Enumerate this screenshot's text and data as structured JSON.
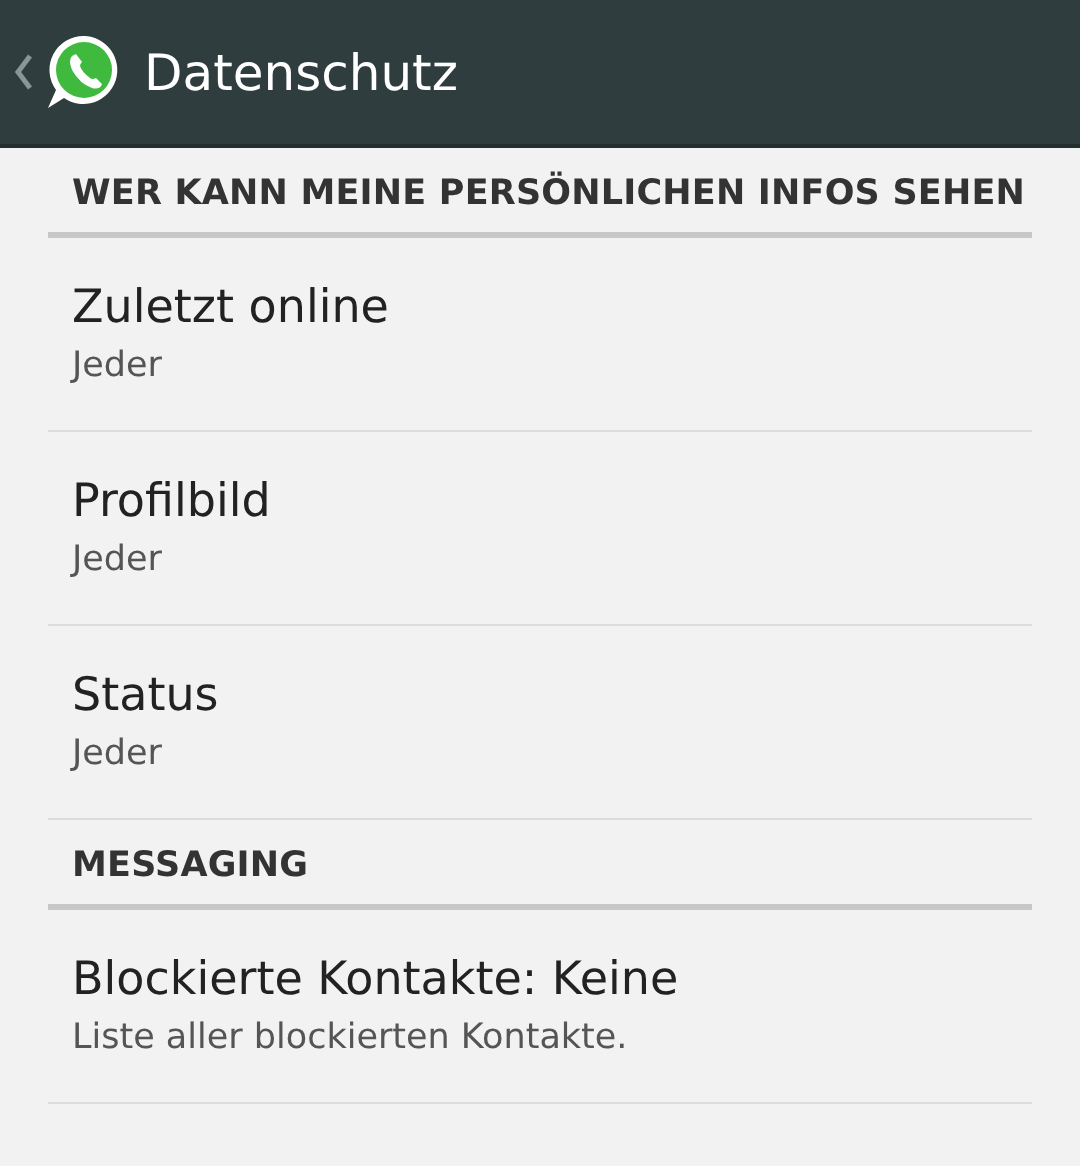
{
  "action_bar": {
    "title": "Datenschutz"
  },
  "sections": [
    {
      "header": "WER KANN MEINE PERSÖNLICHEN INFOS SEHEN",
      "items": [
        {
          "title": "Zuletzt online",
          "summary": "Jeder"
        },
        {
          "title": "Profilbild",
          "summary": "Jeder"
        },
        {
          "title": "Status",
          "summary": "Jeder"
        }
      ]
    },
    {
      "header": "MESSAGING",
      "items": [
        {
          "title": "Blockierte Kontakte: Keine",
          "summary": "Liste aller blockierten Kontakte."
        }
      ]
    }
  ]
}
